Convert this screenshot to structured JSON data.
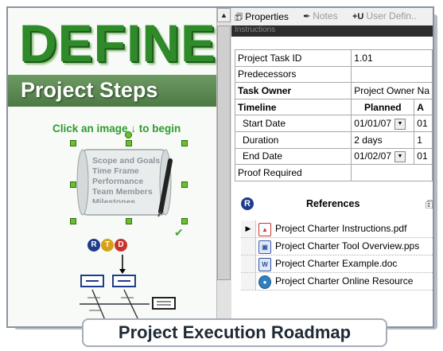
{
  "left_panel": {
    "banner_title": "DEFINE",
    "banner_subtitle": "Project Steps",
    "click_hint": "Click an image ↓ to begin",
    "scroll_items": [
      "Scope and Goals",
      "Time Frame",
      "Performance",
      "Team Members",
      "Milestones"
    ],
    "rtd_badges": [
      {
        "letter": "R",
        "color": "#1f3c8c"
      },
      {
        "letter": "T",
        "color": "#d6a017"
      },
      {
        "letter": "D",
        "color": "#c8322a"
      }
    ],
    "check_icon": "check-icon"
  },
  "tabs": [
    {
      "label": "Properties",
      "icon": "properties-icon",
      "state": "active"
    },
    {
      "label": "Notes",
      "icon": "pen-icon",
      "state": "dim"
    },
    {
      "label": "User Defin..",
      "icon": "+U",
      "state": "dim"
    }
  ],
  "header_bar": "Instructions",
  "properties": {
    "task_id_label": "Project Task ID",
    "task_id_value": "1.01",
    "predecessors_label": "Predecessors",
    "task_owner_label": "Task Owner",
    "task_owner_value": "Project Owner Na",
    "timeline_label": "Timeline",
    "planned_header": "Planned",
    "actual_header": "A",
    "start_label": "Start Date",
    "start_planned": "01/01/07",
    "start_actual": "01",
    "duration_label": "Duration",
    "duration_planned": "2 days",
    "duration_actual": "1",
    "end_label": "End Date",
    "end_planned": "01/02/07",
    "end_actual": "01",
    "proof_label": "Proof Required"
  },
  "references": {
    "badge": "R",
    "title": "References",
    "items": [
      {
        "label": "Project Charter Instructions.pdf",
        "icon": "pdf-icon",
        "selected": true
      },
      {
        "label": "Project Charter Tool Overview.pps",
        "icon": "pps-icon",
        "selected": false
      },
      {
        "label": "Project Charter Example.doc",
        "icon": "doc-icon",
        "selected": false
      },
      {
        "label": "Project Charter Online Resource",
        "icon": "web-icon",
        "selected": false
      }
    ]
  },
  "caption": "Project Execution Roadmap"
}
